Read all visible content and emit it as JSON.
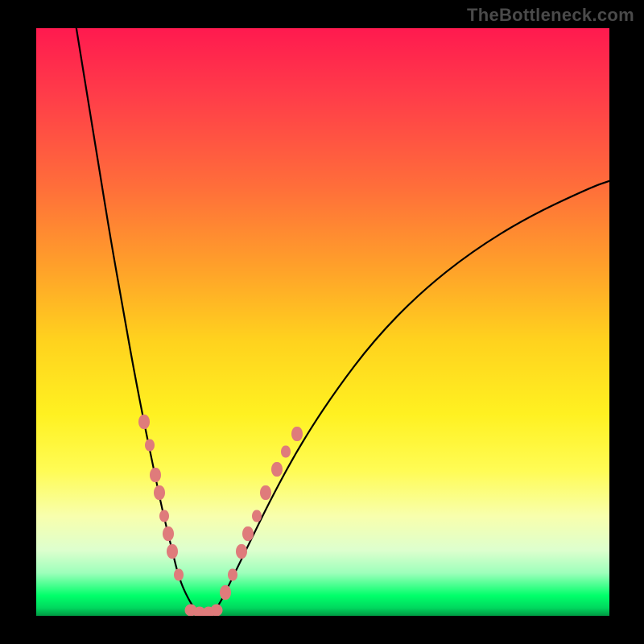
{
  "watermark": "TheBottleneck.com",
  "chart_data": {
    "type": "line",
    "title": "",
    "xlabel": "",
    "ylabel": "",
    "xlim": [
      0,
      100
    ],
    "ylim": [
      0,
      100
    ],
    "grid": false,
    "legend": false,
    "background": "vertical-gradient-red-to-green",
    "series": [
      {
        "name": "bottleneck-curve",
        "segments": [
          {
            "name": "left-descent",
            "x": [
              7,
              9,
              11,
              13,
              15,
              17,
              19,
              20.5,
              22,
              23.5,
              25,
              27
            ],
            "y": [
              100,
              88,
              76,
              64,
              53,
              42,
              32,
              25,
              18,
              12,
              6,
              2
            ]
          },
          {
            "name": "trough",
            "x": [
              27,
              28,
              29,
              30,
              31,
              32
            ],
            "y": [
              2,
              1,
              0.5,
              0.5,
              1,
              2
            ]
          },
          {
            "name": "right-ascent",
            "x": [
              32,
              34,
              37,
              41,
              46,
              52,
              59,
              67,
              76,
              86,
              97,
              100
            ],
            "y": [
              2,
              6,
              12,
              20,
              29,
              38,
              47,
              55,
              62,
              68,
              73,
              74
            ]
          }
        ]
      }
    ],
    "markers": [
      {
        "branch": "left",
        "x": 18.8,
        "y": 33
      },
      {
        "branch": "left",
        "x": 19.8,
        "y": 29
      },
      {
        "branch": "left",
        "x": 20.8,
        "y": 24
      },
      {
        "branch": "left",
        "x": 21.5,
        "y": 21
      },
      {
        "branch": "left",
        "x": 22.3,
        "y": 17
      },
      {
        "branch": "left",
        "x": 23.0,
        "y": 14
      },
      {
        "branch": "left",
        "x": 23.8,
        "y": 11
      },
      {
        "branch": "left",
        "x": 24.8,
        "y": 7
      },
      {
        "branch": "trough",
        "x": 27.0,
        "y": 1
      },
      {
        "branch": "trough",
        "x": 28.5,
        "y": 0.6
      },
      {
        "branch": "trough",
        "x": 30.0,
        "y": 0.6
      },
      {
        "branch": "trough",
        "x": 31.5,
        "y": 1
      },
      {
        "branch": "right",
        "x": 33.0,
        "y": 4
      },
      {
        "branch": "right",
        "x": 34.3,
        "y": 7
      },
      {
        "branch": "right",
        "x": 35.8,
        "y": 11
      },
      {
        "branch": "right",
        "x": 37.0,
        "y": 14
      },
      {
        "branch": "right",
        "x": 38.5,
        "y": 17
      },
      {
        "branch": "right",
        "x": 40.0,
        "y": 21
      },
      {
        "branch": "right",
        "x": 42.0,
        "y": 25
      },
      {
        "branch": "right",
        "x": 43.5,
        "y": 28
      },
      {
        "branch": "right",
        "x": 45.5,
        "y": 31
      }
    ]
  }
}
